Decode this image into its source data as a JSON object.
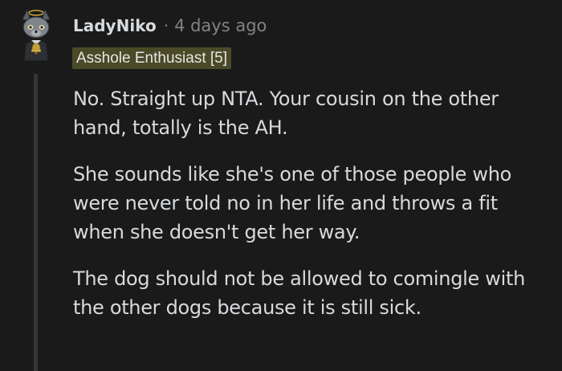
{
  "comment": {
    "author": "LadyNiko",
    "separator": "·",
    "timestamp": "4 days ago",
    "flair": "Asshole Enthusiast [5]",
    "paragraphs": [
      "No. Straight up NTA. Your cousin on the other hand, totally is the AH.",
      "She sounds like she's one of those people who were never told no in her life and throws a fit when she doesn't get her way.",
      "The dog should not be allowed to comingle with the other dogs because it is still sick."
    ]
  },
  "colors": {
    "background": "#1a1a1b",
    "text": "#d7dadc",
    "meta": "#818384",
    "flair_bg": "#4a4a28",
    "thread_line": "#343536",
    "avatar_gold": "#c8a13a"
  },
  "icons": {
    "avatar": "snoo-avatar-icon"
  }
}
